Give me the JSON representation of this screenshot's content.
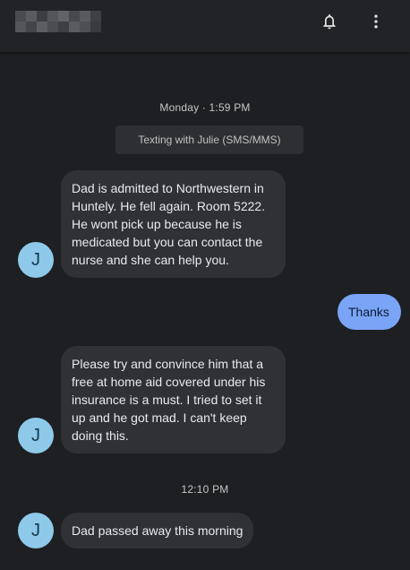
{
  "colors": {
    "background": "#1e1f22",
    "header": "#222327",
    "incoming_bubble": "#303134",
    "outgoing_bubble": "#7aa4f5",
    "avatar": "#8ec9ea"
  },
  "header": {
    "contact_name_redacted": true,
    "notification_icon": "bell-icon",
    "menu_icon": "more-vertical-icon"
  },
  "conversation": {
    "date_label_1": "Monday · 1:59 PM",
    "info_chip": "Texting with Julie (SMS/MMS)",
    "date_label_2": "12:10 PM",
    "messages": [
      {
        "direction": "incoming",
        "avatar_initial": "J",
        "text": "Dad is admitted to Northwestern in Huntely. He fell again. Room 5222. He wont pick up because he is medicated but you can contact the nurse and she can help you."
      },
      {
        "direction": "outgoing",
        "text": "Thanks"
      },
      {
        "direction": "incoming",
        "avatar_initial": "J",
        "text": "Please try and convince him that a free at home aid covered under his insurance is a must. I tried to set it up and he got mad. I can't keep doing this."
      },
      {
        "direction": "incoming",
        "avatar_initial": "J",
        "text": "Dad passed away this morning"
      }
    ]
  }
}
